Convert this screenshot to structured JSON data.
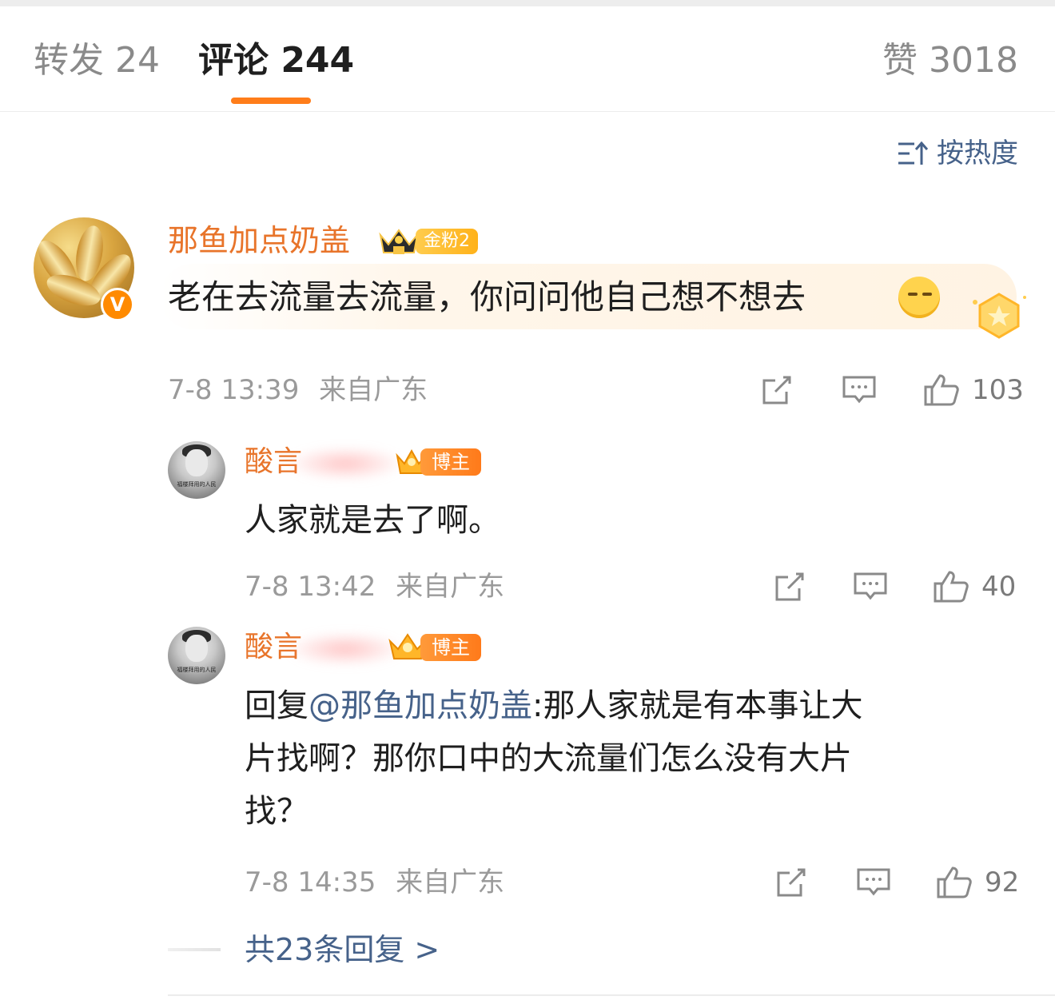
{
  "tabs": {
    "repost_label": "转发 24",
    "comment_label": "评论 244",
    "like_label": "赞 3018"
  },
  "sort": {
    "label": "按热度",
    "icon": "sort-icon"
  },
  "main_comment": {
    "username": "那鱼加点奶盖",
    "badge": "金粉2",
    "verified": "V",
    "text": "老在去流量去流量，你问问他自己想不想去",
    "time": "7-8 13:39",
    "location": "来自广东",
    "likes": "103"
  },
  "replies": [
    {
      "username_visible": "酸言",
      "badge": "博主",
      "text": "人家就是去了啊。",
      "time": "7-8 13:42",
      "location": "来自广东",
      "likes": "40"
    },
    {
      "username_visible": "酸言",
      "badge": "博主",
      "reply_prefix": "回复",
      "mention": "@那鱼加点奶盖",
      "text_line1": ":那人家就是有本事让大",
      "text_line2": "片找啊？那你口中的大流量们怎么没有大片",
      "text_line3": "找？",
      "time": "7-8 14:35",
      "location": "来自广东",
      "likes": "92"
    }
  ],
  "more_replies": "共23条回复 >",
  "colors": {
    "accent": "#ff7d1a",
    "username": "#e8742a",
    "link": "#46628a",
    "meta": "#9a9a9a"
  }
}
